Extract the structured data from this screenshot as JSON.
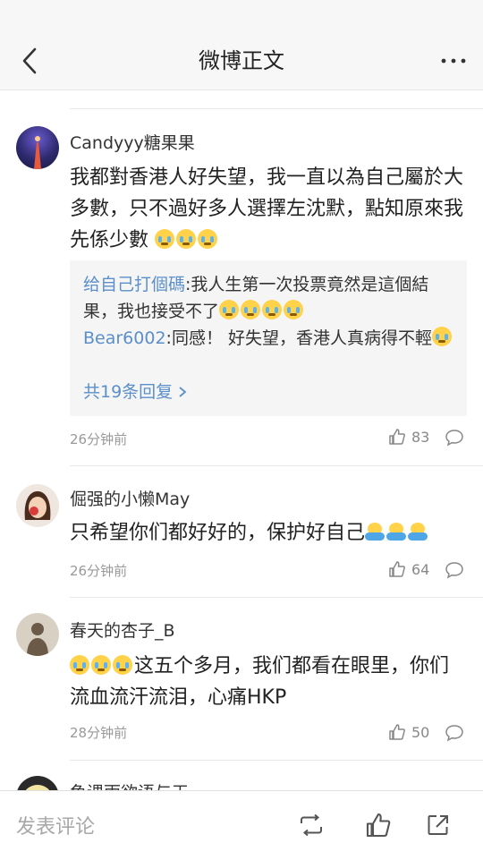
{
  "navbar": {
    "title": "微博正文"
  },
  "comments": [
    {
      "username": "Candyyy糖果果",
      "text": "我都對香港人好失望，我一直以為自己屬於大多數，只不過好多人選擇左沈默，點知原來我先係少數",
      "emoji_count": 3,
      "replies": [
        {
          "name": "给自己打個碼",
          "text": ":我人生第一次投票竟然是這個結果，我也接受不了",
          "emoji_count": 4
        },
        {
          "name": "Bear6002",
          "text": ":同感！ 好失望，香港人真病得不輕",
          "emoji_count": 1
        }
      ],
      "more_replies": "共19条回复",
      "time": "26分钟前",
      "likes": "83"
    },
    {
      "username": "倔强的小懒May",
      "text": "只希望你们都好好的，保护好自己",
      "emoji_count": 3,
      "time": "26分钟前",
      "likes": "64"
    },
    {
      "username": "春天的杏子_B",
      "text": "这五个多月，我们都看在眼里，你们流血流汗流泪，心痛HKP",
      "emoji_count": 3,
      "time": "28分钟前",
      "likes": "50"
    },
    {
      "username": "鱼课雨欲语与天"
    }
  ],
  "bottom_bar": {
    "compose_placeholder": "发表评论"
  },
  "colors": {
    "link": "#5b8fc9",
    "reply_bg": "#f5f5f5",
    "nav_bg": "#f7f7f7"
  },
  "icons": [
    "back-arrow-icon",
    "more-icon",
    "thumbs-up-icon",
    "comment-bubble-icon",
    "repost-icon",
    "share-icon"
  ]
}
